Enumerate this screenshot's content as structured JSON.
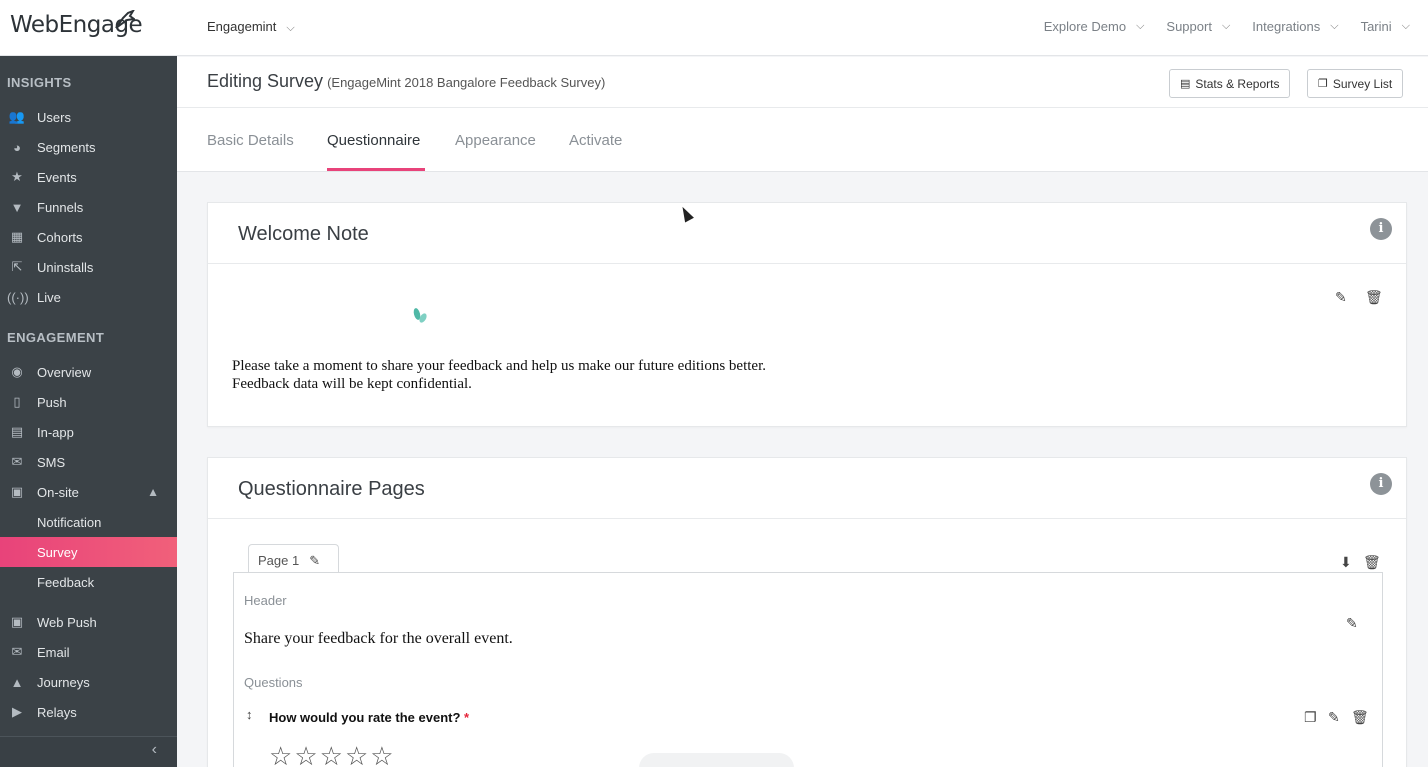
{
  "brand": {
    "logo_text": "WebEngage",
    "accent": "#e8437a",
    "sidebar_bg": "#3b4247"
  },
  "header": {
    "project": "Engagemint",
    "nav": [
      "Explore Demo",
      "Support",
      "Integrations",
      "Tarini"
    ]
  },
  "sidebar": {
    "insights_label": "INSIGHTS",
    "insights": [
      {
        "label": "Users",
        "icon": "users-icon"
      },
      {
        "label": "Segments",
        "icon": "pie-icon"
      },
      {
        "label": "Events",
        "icon": "star-icon"
      },
      {
        "label": "Funnels",
        "icon": "funnel-icon"
      },
      {
        "label": "Cohorts",
        "icon": "grid-icon"
      },
      {
        "label": "Uninstalls",
        "icon": "exit-icon"
      },
      {
        "label": "Live",
        "icon": "broadcast-icon"
      }
    ],
    "engagement_label": "ENGAGEMENT",
    "engagement": [
      {
        "label": "Overview",
        "icon": "eye-icon"
      },
      {
        "label": "Push",
        "icon": "phone-icon"
      },
      {
        "label": "In-app",
        "icon": "device-icon"
      },
      {
        "label": "SMS",
        "icon": "chat-icon"
      },
      {
        "label": "On-site",
        "icon": "window-icon"
      },
      {
        "label": "Notification",
        "icon": ""
      },
      {
        "label": "Survey",
        "icon": ""
      },
      {
        "label": "Feedback",
        "icon": ""
      },
      {
        "label": "Web Push",
        "icon": "web-push-icon"
      },
      {
        "label": "Email",
        "icon": "envelope-icon"
      },
      {
        "label": "Journeys",
        "icon": "rocket-icon"
      },
      {
        "label": "Relays",
        "icon": "megaphone-icon"
      }
    ]
  },
  "page": {
    "title": "Editing Survey",
    "subtitle": "(EngageMint 2018 Bangalore Feedback Survey)",
    "stats_button": "Stats & Reports",
    "list_button": "Survey List"
  },
  "tabs": [
    "Basic Details",
    "Questionnaire",
    "Appearance",
    "Activate"
  ],
  "welcome": {
    "title": "Welcome Note",
    "line1": "Please take a moment to share your feedback and help us make our future editions better.",
    "line2": "Feedback data will be kept confidential."
  },
  "questionnaire": {
    "title": "Questionnaire Pages",
    "page_tab": "Page 1",
    "header_label": "Header",
    "header_text": "Share your feedback for the overall event.",
    "questions_label": "Questions",
    "question1": "How would you rate the event?",
    "required_mark": "*",
    "rating": 0,
    "max_rating": 5
  }
}
